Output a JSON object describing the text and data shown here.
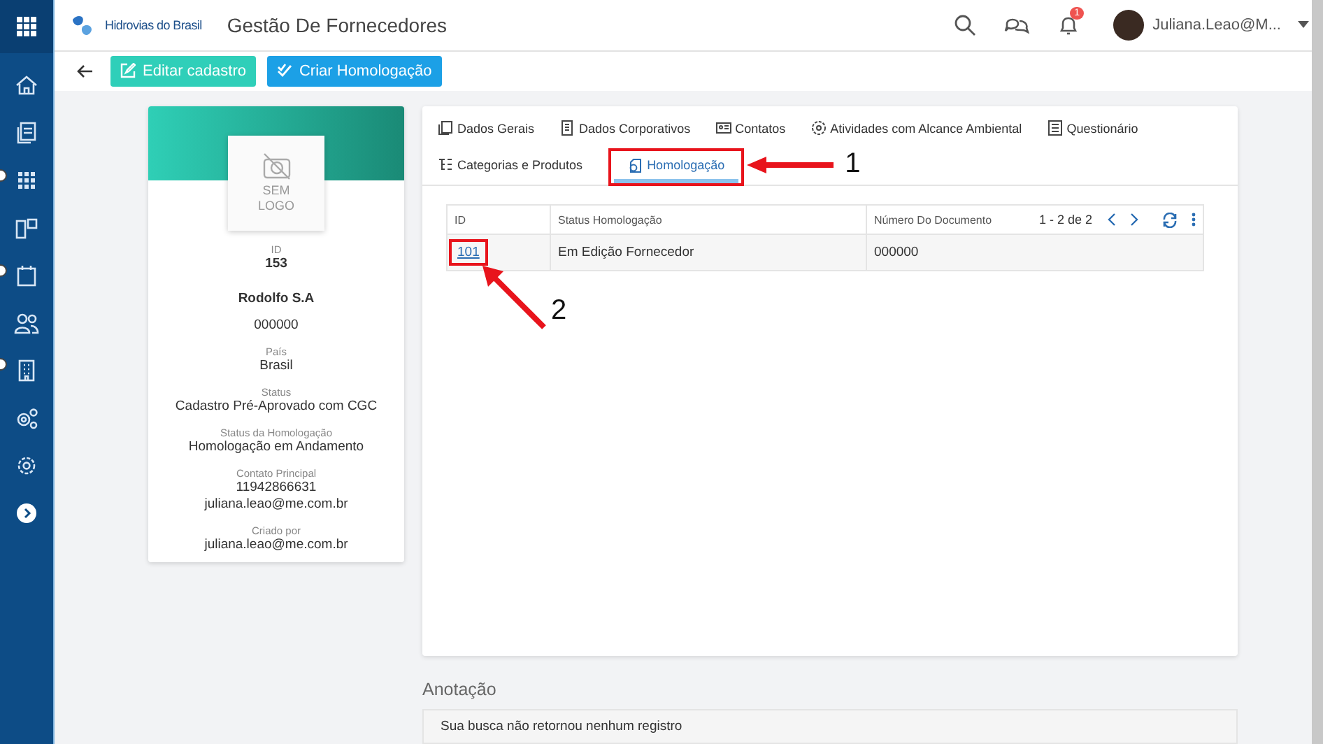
{
  "header": {
    "brand": "Hidrovias do Brasil",
    "title": "Gestão De Fornecedores",
    "notification_count": "1",
    "user": "Juliana.Leao@M..."
  },
  "sidebar": {
    "items": [
      {
        "kind": "home"
      },
      {
        "kind": "docs"
      },
      {
        "kind": "apps"
      },
      {
        "kind": "boards"
      },
      {
        "kind": "calendar"
      },
      {
        "kind": "users"
      },
      {
        "kind": "building"
      },
      {
        "kind": "gears"
      },
      {
        "kind": "settings"
      },
      {
        "kind": "expand"
      }
    ]
  },
  "toolbar": {
    "buttons": [
      {
        "label": "Editar cadastro",
        "kind": "edit"
      },
      {
        "label": "Criar Homologação",
        "kind": "approve"
      }
    ]
  },
  "profile": {
    "logo_text": "SEM LOGO",
    "id_label": "ID",
    "id": "153",
    "name": "Rodolfo S.A",
    "code": "000000",
    "fields": [
      {
        "label": "País",
        "values": [
          "Brasil"
        ]
      },
      {
        "label": "Status",
        "values": [
          "Cadastro Pré-Aprovado com CGC"
        ]
      },
      {
        "label": "Status da Homologação",
        "values": [
          "Homologação em Andamento"
        ]
      },
      {
        "label": "Contato Principal",
        "values": [
          "11942866631",
          "juliana.leao@me.com.br"
        ]
      },
      {
        "label": "Criado por",
        "values": [
          "juliana.leao@me.com.br"
        ]
      }
    ]
  },
  "tabs": [
    [
      {
        "label": "Dados Gerais",
        "kind": "doc",
        "selected": false,
        "highlighted": false
      },
      {
        "label": "Dados Corporativos",
        "kind": "building",
        "selected": false,
        "highlighted": false
      },
      {
        "label": "Contatos",
        "kind": "card",
        "selected": false,
        "highlighted": false
      },
      {
        "label": "Atividades com Alcance Ambiental",
        "kind": "gear",
        "selected": false,
        "highlighted": false
      },
      {
        "label": "Questionário",
        "kind": "form",
        "selected": false,
        "highlighted": false
      }
    ],
    [
      {
        "label": "Categorias e Produtos",
        "kind": "list",
        "selected": false,
        "highlighted": false
      },
      {
        "label": "Homologação",
        "kind": "approval",
        "selected": true,
        "highlighted": true
      }
    ]
  ],
  "table": {
    "columns": [
      "ID",
      "Status Homologação",
      "Número Do Documento"
    ],
    "pagination": "1 - 2 de 2",
    "rows": [
      {
        "cells": [
          "101",
          "Em Edição Fornecedor",
          "000000"
        ],
        "highlighted": true
      }
    ]
  },
  "annotation": {
    "title": "Anotação",
    "empty_message": "Sua busca não retornou nenhum registro"
  },
  "callouts": [
    {
      "label": "1"
    },
    {
      "label": "2"
    }
  ]
}
